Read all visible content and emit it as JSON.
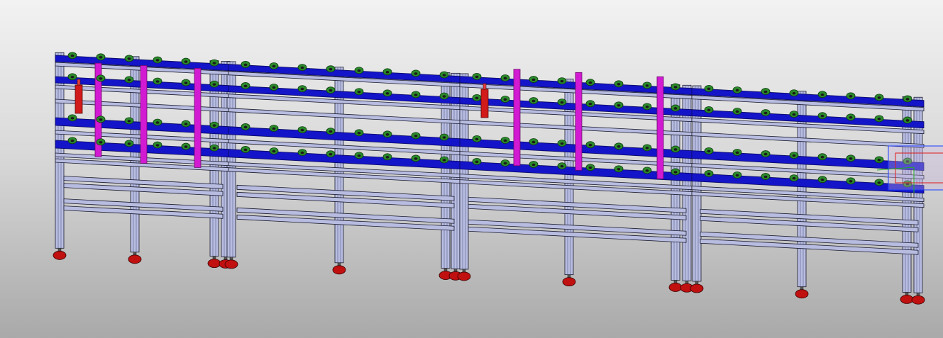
{
  "viewport": {
    "title": "",
    "background_top": "#f2f2f2",
    "background_bottom": "#a9a9a9"
  },
  "model": {
    "kind": "roller conveyor frame assembly",
    "modules": 4,
    "colors": {
      "frame": "#b7bce0",
      "frame_edge": "#1b1b2e",
      "conveyor_beam": "#1414c8",
      "roller": "#2a8a2a",
      "upright_accent": "#d21ad2",
      "cylinder": "#d11a1a",
      "foot": "#c01010"
    }
  },
  "triad": {
    "icon": "coordinate-triad-icon",
    "colors": [
      "#1a3cff",
      "#e01a1a",
      "#20b020"
    ]
  }
}
